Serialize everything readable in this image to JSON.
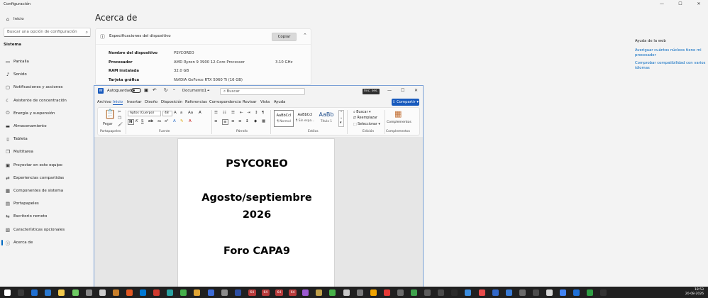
{
  "settings": {
    "window_title": "Configuración",
    "controls": {
      "minimize": "—",
      "maximize": "☐",
      "close": "✕"
    },
    "nav_top": [
      {
        "label": "Inicio",
        "icon": "home-icon",
        "glyph": "⌂"
      }
    ],
    "search_placeholder": "Buscar una opción de configuración",
    "section": "Sistema",
    "nav_items": [
      {
        "label": "Pantalla",
        "icon": "display-icon",
        "glyph": "▭"
      },
      {
        "label": "Sonido",
        "icon": "sound-icon",
        "glyph": "♪"
      },
      {
        "label": "Notificaciones y acciones",
        "icon": "notifications-icon",
        "glyph": "▢"
      },
      {
        "label": "Asistente de concentración",
        "icon": "moon-icon",
        "glyph": "☾"
      },
      {
        "label": "Energía y suspensión",
        "icon": "power-icon",
        "glyph": "⏻"
      },
      {
        "label": "Almacenamiento",
        "icon": "storage-icon",
        "glyph": "▬"
      },
      {
        "label": "Tableta",
        "icon": "tablet-icon",
        "glyph": "▯"
      },
      {
        "label": "Multitarea",
        "icon": "multitask-icon",
        "glyph": "❐"
      },
      {
        "label": "Proyectar en este equipo",
        "icon": "project-icon",
        "glyph": "▣"
      },
      {
        "label": "Experiencias compartidas",
        "icon": "share-icon",
        "glyph": "⇄"
      },
      {
        "label": "Componentes de sistema",
        "icon": "components-icon",
        "glyph": "▦"
      },
      {
        "label": "Portapapeles",
        "icon": "clipboard-icon",
        "glyph": "▤"
      },
      {
        "label": "Escritorio remoto",
        "icon": "remote-icon",
        "glyph": "⇆"
      },
      {
        "label": "Características opcionales",
        "icon": "optional-icon",
        "glyph": "▧"
      },
      {
        "label": "Acerca de",
        "icon": "info-icon",
        "glyph": "ⓘ"
      }
    ],
    "page_title": "Acerca de",
    "card": {
      "title": "Especificaciones del dispositivo",
      "copy_label": "Copiar",
      "specs": [
        {
          "key": "Nombre del dispositivo",
          "value": "PSYCOREO",
          "extra": ""
        },
        {
          "key": "Procesador",
          "value": "AMD Ryzen 9 3900 12-Core Processor",
          "extra": "3.10 GHz"
        },
        {
          "key": "RAM instalada",
          "value": "32.0 GB",
          "extra": ""
        },
        {
          "key": "Tarjeta gráfica",
          "value": "NVIDIA GeForce RTX 5060 Ti (16 GB)",
          "extra": ""
        }
      ]
    },
    "web_help": {
      "title": "Ayuda de la web",
      "links": [
        "Averiguar cuántos núcleos tiene mi procesador",
        "Comprobar compatibilidad con varios idiomas"
      ]
    }
  },
  "word": {
    "autosave_label": "Autoguardado",
    "doc_name": "Documento1",
    "doc_suffix": "•",
    "search_placeholder": "Buscar",
    "user_label": "Inic. ses.",
    "tabs": [
      "Archivo",
      "Inicio",
      "Insertar",
      "Diseño",
      "Disposición",
      "Referencias",
      "Correspondencia",
      "Revisar",
      "Vista",
      "Ayuda"
    ],
    "share_label": "Compartir",
    "ribbon": {
      "paste_label": "Pegar",
      "font_name": "Aptos (Cuerpo)",
      "font_size": "48",
      "groups": [
        "Portapapeles",
        "Fuente",
        "Párrafo",
        "Estilos",
        "Edición",
        "Complementos"
      ],
      "styles": [
        {
          "sample": "AaBbCcI",
          "name": "¶ Normal"
        },
        {
          "sample": "AaBbCcI",
          "name": "¶ Sin espa..."
        },
        {
          "sample": "AaBb",
          "name": "Título 1"
        }
      ],
      "edit": [
        "Buscar",
        "Reemplazar",
        "Seleccionar"
      ],
      "addins_label": "Complementos"
    },
    "document_lines": [
      "PSYCOREO",
      "Agosto/septiembre",
      "2026",
      "Foro CAPA9"
    ]
  },
  "taskbar": {
    "time": "18:53",
    "date": "20-08-2026",
    "badge": "64"
  }
}
